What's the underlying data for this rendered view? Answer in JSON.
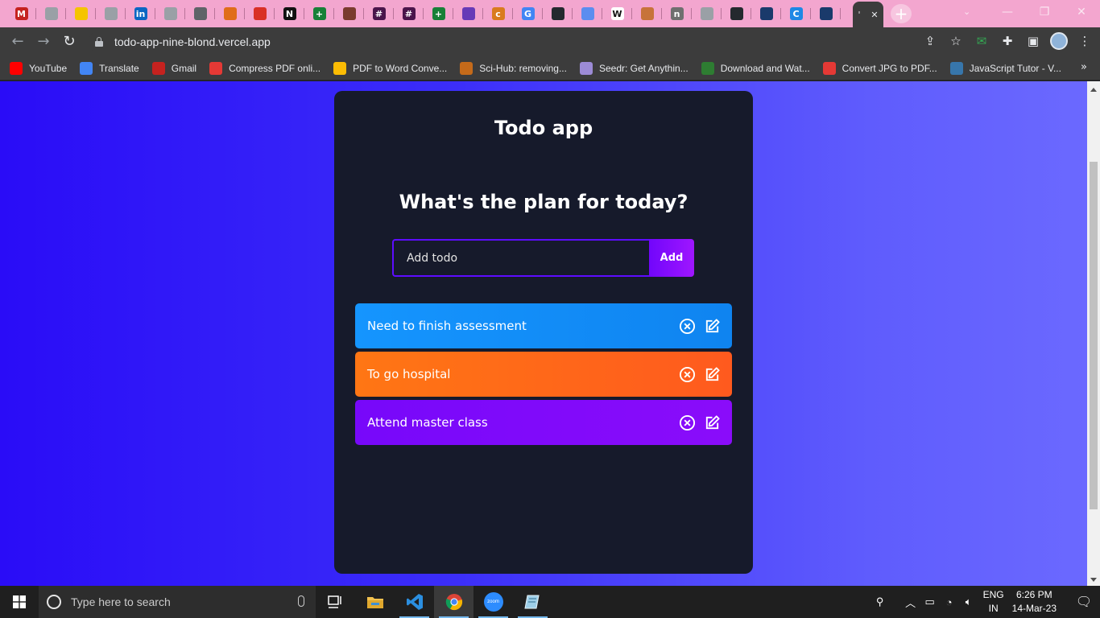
{
  "browser": {
    "tabs": [
      {
        "icon": "gmail-icon",
        "color": "#c5221f",
        "glyph": "M"
      },
      {
        "icon": "tab-generic-icon",
        "color": "#9aa0a6",
        "glyph": ""
      },
      {
        "icon": "tab-yellow-icon",
        "color": "#f5c400",
        "glyph": ""
      },
      {
        "icon": "tab-generic-icon",
        "color": "#9aa0a6",
        "glyph": ""
      },
      {
        "icon": "linkedin-icon",
        "color": "#0a66c2",
        "glyph": "in"
      },
      {
        "icon": "tab-generic-icon",
        "color": "#9aa0a6",
        "glyph": ""
      },
      {
        "icon": "history-icon",
        "color": "#5f6368",
        "glyph": ""
      },
      {
        "icon": "tab-orange-icon",
        "color": "#e06d1a",
        "glyph": ""
      },
      {
        "icon": "tab-red-icon",
        "color": "#d93025",
        "glyph": ""
      },
      {
        "icon": "notion-icon",
        "color": "#111111",
        "glyph": "N"
      },
      {
        "icon": "sheets-icon",
        "color": "#188038",
        "glyph": "+"
      },
      {
        "icon": "tab-avatar-icon",
        "color": "#7a3b2e",
        "glyph": ""
      },
      {
        "icon": "slack-icon",
        "color": "#4a154b",
        "glyph": "#"
      },
      {
        "icon": "slack-icon",
        "color": "#4a154b",
        "glyph": "#"
      },
      {
        "icon": "sheets-icon",
        "color": "#188038",
        "glyph": "+"
      },
      {
        "icon": "tab-purple-icon",
        "color": "#673ab7",
        "glyph": ""
      },
      {
        "icon": "tab-coursera-icon",
        "color": "#d97b1f",
        "glyph": "c"
      },
      {
        "icon": "translate-icon",
        "color": "#4285f4",
        "glyph": "G"
      },
      {
        "icon": "github-icon",
        "color": "#24292e",
        "glyph": ""
      },
      {
        "icon": "tab-feather-icon",
        "color": "#5b8def",
        "glyph": ""
      },
      {
        "icon": "tab-w-icon",
        "color": "#ffffff",
        "glyph": "W"
      },
      {
        "icon": "tab-stack-icon",
        "color": "#c7733a",
        "glyph": ""
      },
      {
        "icon": "tab-n-icon",
        "color": "#6f6f6f",
        "glyph": "n"
      },
      {
        "icon": "tab-generic-icon",
        "color": "#9aa0a6",
        "glyph": ""
      },
      {
        "icon": "github-icon",
        "color": "#24292e",
        "glyph": ""
      },
      {
        "icon": "tab-cp-icon",
        "color": "#1a3a6b",
        "glyph": ""
      },
      {
        "icon": "tab-c-icon",
        "color": "#1e88e5",
        "glyph": "C"
      },
      {
        "icon": "tab-cp-icon",
        "color": "#1a3a6b",
        "glyph": ""
      }
    ],
    "active_tab_label": "'",
    "url": "todo-app-nine-blond.vercel.app",
    "bookmarks": [
      {
        "label": "YouTube",
        "icon": "youtube-icon",
        "color": "#ff0000"
      },
      {
        "label": "Translate",
        "icon": "translate-icon",
        "color": "#4285f4"
      },
      {
        "label": "Gmail",
        "icon": "gmail-icon",
        "color": "#c5221f"
      },
      {
        "label": "Compress PDF onli...",
        "icon": "heart-pdf-icon",
        "color": "#e53935"
      },
      {
        "label": "PDF to Word Conve...",
        "icon": "pdf-word-icon",
        "color": "#fbbc04"
      },
      {
        "label": "Sci-Hub: removing...",
        "icon": "scihub-icon",
        "color": "#c46a1a"
      },
      {
        "label": "Seedr: Get Anythin...",
        "icon": "seedr-icon",
        "color": "#9c8bd6"
      },
      {
        "label": "Download and Wat...",
        "icon": "tr-icon",
        "color": "#2e7d32"
      },
      {
        "label": "Convert JPG to PDF...",
        "icon": "heart-pdf-icon",
        "color": "#e53935"
      },
      {
        "label": "JavaScript Tutor - V...",
        "icon": "python-icon",
        "color": "#3776ab"
      }
    ]
  },
  "app": {
    "title": "Todo app",
    "subtitle": "What's the plan for today?",
    "input_placeholder": "Add todo",
    "add_label": "Add",
    "todos": [
      {
        "text": "Need to finish assessment",
        "color": "blue"
      },
      {
        "text": "To go hospital",
        "color": "orange"
      },
      {
        "text": "Attend master class",
        "color": "purple"
      }
    ]
  },
  "taskbar": {
    "search_placeholder": "Type here to search",
    "apps": [
      "task-view-icon",
      "file-explorer-icon",
      "vscode-icon",
      "chrome-icon",
      "zoom-icon",
      "notepad-icon"
    ],
    "zoom_label": "zoom",
    "lang_top": "ENG",
    "lang_bottom": "IN",
    "time": "6:26 PM",
    "date": "14-Mar-23"
  }
}
